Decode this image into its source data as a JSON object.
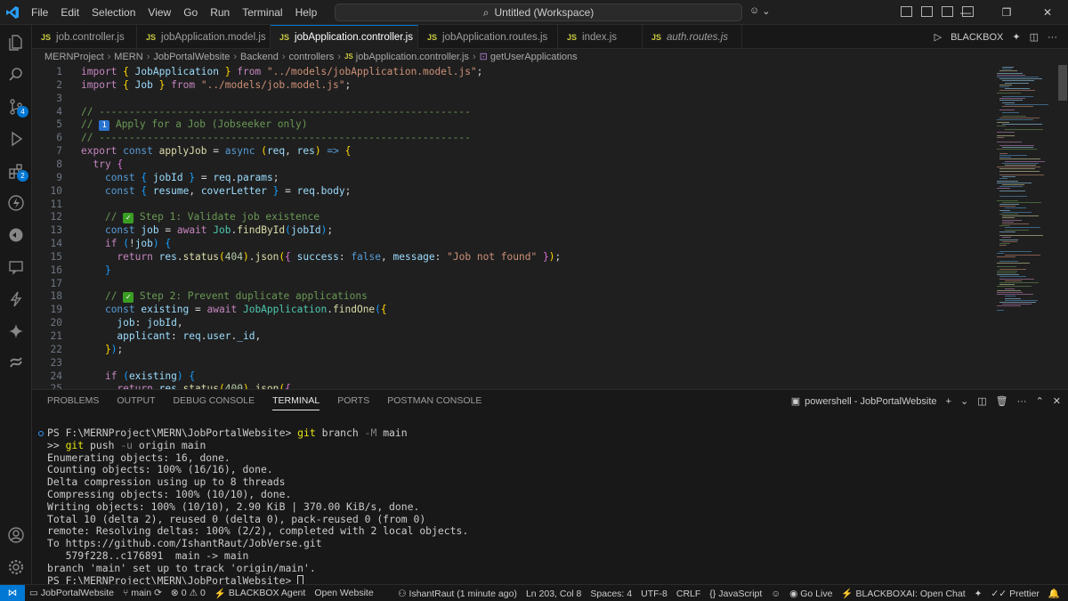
{
  "menu": [
    "File",
    "Edit",
    "Selection",
    "View",
    "Go",
    "Run",
    "Terminal",
    "Help"
  ],
  "search": {
    "label": "Untitled (Workspace)"
  },
  "tabs": [
    {
      "label": "job.controller.js"
    },
    {
      "label": "jobApplication.model.js"
    },
    {
      "label": "jobApplication.controller.js"
    },
    {
      "label": "jobApplication.routes.js"
    },
    {
      "label": "index.js"
    },
    {
      "label": "auth.routes.js"
    }
  ],
  "tab_icon": "JS",
  "tab_right": {
    "label": "BLACKBOX"
  },
  "breadcrumb": [
    "MERNProject",
    "MERN",
    "JobPortalWebsite",
    "Backend",
    "controllers",
    "jobApplication.controller.js",
    "getUserApplications"
  ],
  "code": [
    {
      "n": "1",
      "html": "<span class='ctl'>import</span> <span class='br1'>{</span> <span class='vr'>JobApplication</span> <span class='br1'>}</span> <span class='ctl'>from</span> <span class='str'>\"../models/jobApplication.model.js\"</span><span class='pn'>;</span>"
    },
    {
      "n": "2",
      "html": "<span class='ctl'>import</span> <span class='br1'>{</span> <span class='vr'>Job</span> <span class='br1'>}</span> <span class='ctl'>from</span> <span class='str'>\"../models/job.model.js\"</span><span class='pn'>;</span>"
    },
    {
      "n": "3",
      "html": ""
    },
    {
      "n": "4",
      "html": "<span class='cm'>// --------------------------------------------------------------</span>"
    },
    {
      "n": "5",
      "html": "<span class='cm'>// <span class='boxnum'>1</span> Apply for a Job (Jobseeker only)</span>"
    },
    {
      "n": "6",
      "html": "<span class='cm'>// --------------------------------------------------------------</span>"
    },
    {
      "n": "7",
      "html": "<span class='ctl'>export</span> <span class='kw'>const</span> <span class='fn'>applyJob</span> <span class='pn'>=</span> <span class='kw'>async</span> <span class='br1'>(</span><span class='vr'>req</span><span class='pn'>,</span> <span class='vr'>res</span><span class='br1'>)</span> <span class='kw'>=&gt;</span> <span class='br1'>{</span>"
    },
    {
      "n": "8",
      "html": "  <span class='ctl'>try</span> <span class='br2'>{</span>"
    },
    {
      "n": "9",
      "html": "    <span class='kw'>const</span> <span class='br3'>{</span> <span class='vr'>jobId</span> <span class='br3'>}</span> <span class='pn'>=</span> <span class='vr'>req</span><span class='pn'>.</span><span class='vr'>params</span><span class='pn'>;</span>"
    },
    {
      "n": "10",
      "html": "    <span class='kw'>const</span> <span class='br3'>{</span> <span class='vr'>resume</span><span class='pn'>,</span> <span class='vr'>coverLetter</span> <span class='br3'>}</span> <span class='pn'>=</span> <span class='vr'>req</span><span class='pn'>.</span><span class='vr'>body</span><span class='pn'>;</span>"
    },
    {
      "n": "11",
      "html": ""
    },
    {
      "n": "12",
      "html": "    <span class='cm'>// <span class='check'>✓</span> Step 1: Validate job existence</span>"
    },
    {
      "n": "13",
      "html": "    <span class='kw'>const</span> <span class='vr'>job</span> <span class='pn'>=</span> <span class='ctl'>await</span> <span class='cls'>Job</span><span class='pn'>.</span><span class='fn'>findById</span><span class='br3'>(</span><span class='vr'>jobId</span><span class='br3'>)</span><span class='pn'>;</span>"
    },
    {
      "n": "14",
      "html": "    <span class='ctl'>if</span> <span class='br3'>(</span><span class='pn'>!</span><span class='vr'>job</span><span class='br3'>)</span> <span class='br3'>{</span>"
    },
    {
      "n": "15",
      "html": "      <span class='ctl'>return</span> <span class='vr'>res</span><span class='pn'>.</span><span class='fn'>status</span><span class='br1'>(</span><span class='num'>404</span><span class='br1'>)</span><span class='pn'>.</span><span class='fn'>json</span><span class='br1'>(</span><span class='br2'>{</span> <span class='vr'>success</span><span class='pn'>:</span> <span class='kw'>false</span><span class='pn'>,</span> <span class='vr'>message</span><span class='pn'>:</span> <span class='str'>\"Job not found\"</span> <span class='br2'>}</span><span class='br1'>)</span><span class='pn'>;</span>"
    },
    {
      "n": "16",
      "html": "    <span class='br3'>}</span>"
    },
    {
      "n": "17",
      "html": ""
    },
    {
      "n": "18",
      "html": "    <span class='cm'>// <span class='check'>✓</span> Step 2: Prevent duplicate applications</span>"
    },
    {
      "n": "19",
      "html": "    <span class='kw'>const</span> <span class='vr'>existing</span> <span class='pn'>=</span> <span class='ctl'>await</span> <span class='cls'>JobApplication</span><span class='pn'>.</span><span class='fn'>findOne</span><span class='br3'>(</span><span class='br1'>{</span>"
    },
    {
      "n": "20",
      "html": "      <span class='vr'>job</span><span class='pn'>:</span> <span class='vr'>jobId</span><span class='pn'>,</span>"
    },
    {
      "n": "21",
      "html": "      <span class='vr'>applicant</span><span class='pn'>:</span> <span class='vr'>req</span><span class='pn'>.</span><span class='vr'>user</span><span class='pn'>.</span><span class='vr'>_id</span><span class='pn'>,</span>"
    },
    {
      "n": "22",
      "html": "    <span class='br1'>}</span><span class='br3'>)</span><span class='pn'>;</span>"
    },
    {
      "n": "23",
      "html": ""
    },
    {
      "n": "24",
      "html": "    <span class='ctl'>if</span> <span class='br3'>(</span><span class='vr'>existing</span><span class='br3'>)</span> <span class='br3'>{</span>"
    },
    {
      "n": "25",
      "html": "      <span class='ctl'>return</span> <span class='vr'>res</span><span class='pn'>.</span><span class='fn'>status</span><span class='br1'>(</span><span class='num'>400</span><span class='br1'>)</span><span class='pn'>.</span><span class='fn'>json</span><span class='br1'>(</span><span class='br2'>{</span>"
    }
  ],
  "panel_tabs": [
    "PROBLEMS",
    "OUTPUT",
    "DEBUG CONSOLE",
    "TERMINAL",
    "PORTS",
    "POSTMAN CONSOLE"
  ],
  "panel_active": "TERMINAL",
  "terminal_name": "powershell - JobPortalWebsite",
  "terminal": [
    {
      "prompt": "PS F:\\MERNProject\\MERN\\JobPortalWebsite> ",
      "cmd": "git",
      "args": " branch ",
      "flag": "-M",
      "rest": " main"
    },
    {
      "prompt": ">> ",
      "cmd": "git",
      "args": " push ",
      "flag": "-u",
      "rest": " origin main"
    },
    {
      "text": "Enumerating objects: 16, done."
    },
    {
      "text": "Counting objects: 100% (16/16), done."
    },
    {
      "text": "Delta compression using up to 8 threads"
    },
    {
      "text": "Compressing objects: 100% (10/10), done."
    },
    {
      "text": "Writing objects: 100% (10/10), 2.90 KiB | 370.00 KiB/s, done."
    },
    {
      "text": "Total 10 (delta 2), reused 0 (delta 0), pack-reused 0 (from 0)"
    },
    {
      "text": "remote: Resolving deltas: 100% (2/2), completed with 2 local objects."
    },
    {
      "text": "To https://github.com/IshantRaut/JobVerse.git"
    },
    {
      "text": "   579f228..c176891  main -> main"
    },
    {
      "text": "branch 'main' set up to track 'origin/main'."
    },
    {
      "text": "PS F:\\MERNProject\\MERN\\JobPortalWebsite> "
    }
  ],
  "status": {
    "folder": "JobPortalWebsite",
    "branch": "main",
    "errors": "0",
    "warnings": "0",
    "blackbox_agent": "BLACKBOX Agent",
    "open_website": "Open Website",
    "blame": "IshantRaut (1 minute ago)",
    "position": "Ln 203, Col 8",
    "spaces": "Spaces: 4",
    "encoding": "UTF-8",
    "eol": "CRLF",
    "language": "JavaScript",
    "golive": "Go Live",
    "blackboxai": "BLACKBOXAI: Open Chat",
    "prettier": "Prettier"
  },
  "colors": {
    "accent": "#0078d4",
    "editor_bg": "#1f1f1f",
    "chrome_bg": "#181818"
  }
}
